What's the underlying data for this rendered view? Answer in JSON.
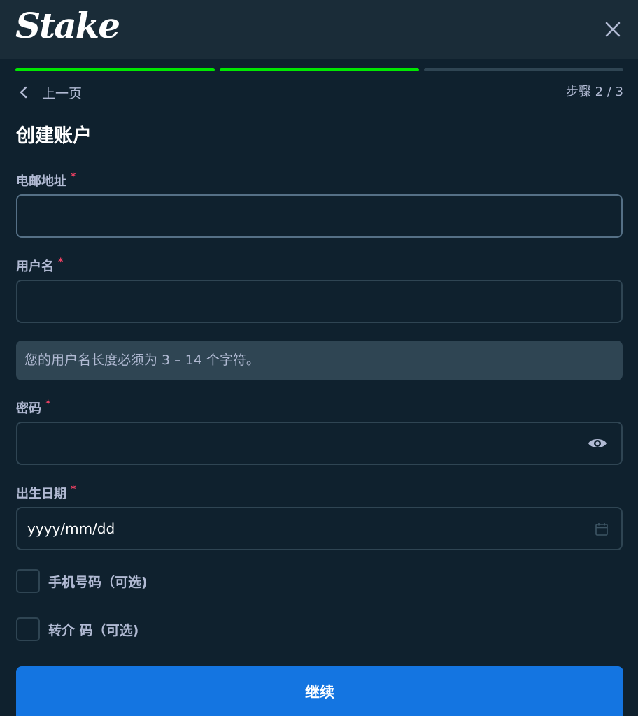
{
  "header": {
    "logo_text": "Stake"
  },
  "progress": {
    "current_step": 2,
    "total_steps": 3
  },
  "nav": {
    "back_label": "上一页",
    "step_label": "步骤 2 / 3"
  },
  "form": {
    "title": "创建账户",
    "required_mark": "*",
    "email": {
      "label": "电邮地址",
      "value": ""
    },
    "username": {
      "label": "用户名",
      "value": "",
      "hint": "您的用户名长度必须为 3 – 14 个字符。"
    },
    "password": {
      "label": "密码",
      "value": ""
    },
    "dob": {
      "label": "出生日期",
      "placeholder": "yyyy/mm/dd"
    },
    "phone_optional": {
      "label": "手机号码（可选)"
    },
    "referral_optional": {
      "label": "转介 码（可选)"
    },
    "submit_label": "继续"
  },
  "colors": {
    "background": "#0f212e",
    "header": "#1a2c38",
    "progress_done": "#00e701",
    "progress_todo": "#2f4553",
    "primary_button": "#1475e1",
    "required": "#ed4163"
  },
  "icons": [
    "close-icon",
    "chevron-left-icon",
    "eye-icon",
    "calendar-icon"
  ]
}
